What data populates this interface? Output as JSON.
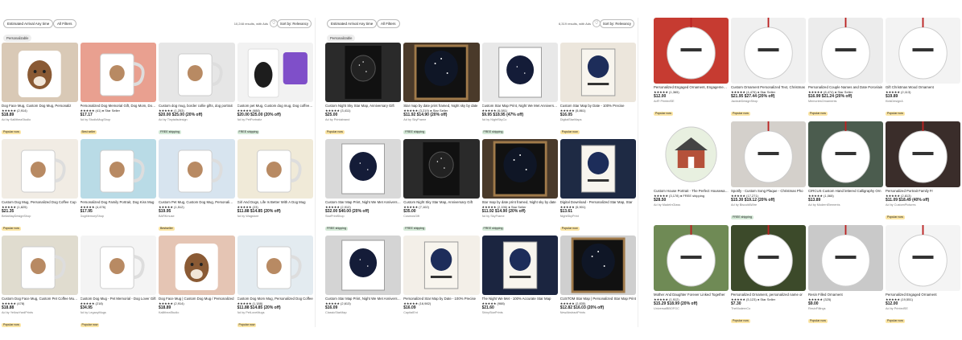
{
  "panels": [
    {
      "filter_label": "Estimated Arrival Any time",
      "all_filters_label": "All Filters",
      "results_text": "10,248 results, with Ads",
      "sort_label": "Sort by: Relevancy",
      "applied_filter": "Personalizable",
      "products": [
        {
          "title": "Dog Face Mug, Custom Dog Mug, Personaliz",
          "rating": "★★★★★ (2,914)",
          "price": "$18.89",
          "shop": "Ad by KallitheaStudio",
          "badge": "Popular now",
          "bg": "#d9c9b6",
          "art": "dog"
        },
        {
          "title": "Personalized Dog Memorial Gift, Dog Mom, Dog Lover",
          "rating": "★★★★★ (41) ● Star Seller",
          "price": "$17.17",
          "shop": "Ad by StudioMugShop",
          "badge": "Best seller",
          "bg": "#e9a090",
          "art": "mug"
        },
        {
          "title": "Custom dog mug, border collie gifts, dog portrait",
          "rating": "★★★★★ (1,253)",
          "price": "$20.00 $25.00 (20% off)",
          "shop": "Ad by Tinytailsdesign",
          "badge": "FREE shipping",
          "bg": "#e6e6e6",
          "art": "mug"
        },
        {
          "title": "Custom pet Mug, Custom dog mug, Dog coffee mug",
          "rating": "★★★★★ (688)",
          "price": "$20.00 $25.00 (20% off)",
          "shop": "Ad by PetPortraitz",
          "badge": "FREE shipping",
          "bg": "#f2f2f2",
          "art": "dogportrait"
        },
        {
          "title": "Custom Dog Mug, Personalized Dog Coffee Cup",
          "rating": "★★★★★ (1,825)",
          "price": "$21.35",
          "shop": "BellaMayDesignShop",
          "badge": "Popular now",
          "bg": "#f1ece4",
          "art": "mug"
        },
        {
          "title": "Personalized Dog Family Portrait, Dog Kiss Mug",
          "rating": "★★★★★ (4,476)",
          "price": "$17.95",
          "shop": "DogMemoryShop",
          "badge": "",
          "bg": "#b9dbe6",
          "art": "mug"
        },
        {
          "title": "Custom Pet Mug, Custom Dog Mug, Personalized Pet",
          "rating": "★★★★★ (1,512)",
          "price": "$19.95",
          "shop": "BARKmuse",
          "badge": "Bestseller",
          "bg": "#d7e4ef",
          "art": "mug"
        },
        {
          "title": "Girl And Dogs, Life Is Better With A Dog Mug",
          "rating": "★★★★★ (23)",
          "price": "$11.88 $14.85 (20% off)",
          "shop": "Ad by Wagstore",
          "badge": "",
          "bg": "#f0ead8",
          "art": "mug"
        },
        {
          "title": "Custom Dog Face Mug, Custom Pet Coffee Mug from Dog Photo",
          "rating": "★★★★★ (478)",
          "price": "$18.88",
          "shop": "Ad by YellowYardPrints",
          "badge": "Popular now",
          "bg": "#e0dccf",
          "art": "mug"
        },
        {
          "title": "Custom Dog Mug - Pet Memorial - Dog Lover Gift",
          "rating": "★★★★★ (218)",
          "price": "$34.95",
          "shop": "Ad by LegacyMugs",
          "badge": "Popular now",
          "bg": "#f4f4f4",
          "art": "mug"
        },
        {
          "title": "Dog Face Mug | Custom Dog Mug / Personalized",
          "rating": "★★★★★ (2,914)",
          "price": "$18.89",
          "shop": "KallitheaStudio",
          "badge": "",
          "bg": "#e5c5b4",
          "art": "dog"
        },
        {
          "title": "Custom Dog Mom Mug, Personalized Dog Coffee",
          "rating": "★★★★★ (1,188)",
          "price": "$11.88 $14.85 (20% off)",
          "shop": "Ad by PetLoveMugs",
          "badge": "Popular now",
          "bg": "#e3ebf0",
          "art": "mug"
        }
      ]
    },
    {
      "filter_label": "Estimated Arrival Any time",
      "all_filters_label": "All Filters",
      "results_text": "6,319 results, with Ads",
      "sort_label": "Sort by: Relevancy",
      "applied_filter": "Personalizable",
      "products": [
        {
          "title": "Custom Night Sky Star Map, Anniversary Gift",
          "rating": "★★★★★ (3,411)",
          "price": "$25.00",
          "shop": "Ad by Printabrand",
          "badge": "Popular now",
          "bg": "#2a2a2a",
          "art": "starframe"
        },
        {
          "title": "Star map by date print framed, Night sky by date",
          "rating": "★★★★★ (3,219) ● Star Seller",
          "price": "$11.92 $14.90 (20% off)",
          "shop": "Ad by SkyFrame",
          "badge": "FREE shipping",
          "bg": "#4a3a2a",
          "art": "starbig"
        },
        {
          "title": "Custom Star Map Print, Night We Met Anniversary",
          "rating": "★★★★★ (6,081)",
          "price": "$9.95 $18.95 (47% off)",
          "shop": "Ad by NightSkyCo",
          "badge": "FREE shipping",
          "bg": "#e8e8e8",
          "art": "stardisc"
        },
        {
          "title": "Custom Star Map by Date - 100% Precise",
          "rating": "★★★★★ (5,861)",
          "price": "$16.05",
          "shop": "DigitalStarMaps",
          "badge": "Popular now",
          "bg": "#ece6dc",
          "art": "starwall"
        },
        {
          "title": "Custom Star Map Print, Night We Met Anniversary",
          "rating": "★★★★★ (2,910)",
          "price": "$32.00 $40.00 (20% off)",
          "shop": "StarPrintShop",
          "badge": "FREE shipping",
          "bg": "#d9d9d9",
          "art": "stardisc"
        },
        {
          "title": "Custom Night Sky Star Map, Anniversary Gift",
          "rating": "★★★★★ (7,102)",
          "price": "$35.00",
          "shop": "CosmosGift",
          "badge": "FREE shipping",
          "bg": "#2a2a2a",
          "art": "starframe"
        },
        {
          "title": "Star map by date print framed, Night sky by date",
          "rating": "★★★★★ (2,196) ● Star Seller",
          "price": "$11.92 $14.90 (20% off)",
          "shop": "Ad by SkyFrame",
          "badge": "FREE shipping",
          "bg": "#4a3a2a",
          "art": "starbig"
        },
        {
          "title": "Digital Download - Personalized Star Map, Star",
          "rating": "★★★★★ (5,901)",
          "price": "$13.61",
          "shop": "NightSkyPrint",
          "badge": "Popular now",
          "bg": "#1e2a44",
          "art": "starwall"
        },
        {
          "title": "Custom Star Map Print, Night We Met Anniversary",
          "rating": "★★★★★ (2,613)",
          "price": "$16.09",
          "shop": "ClassicStarMap",
          "badge": "",
          "bg": "#d4d4d4",
          "art": "stardisc"
        },
        {
          "title": "Personalized Star Map by Date - 100% Precise",
          "rating": "★★★★★ (16,982)",
          "price": "$16.09",
          "shop": "CapitalEnt",
          "badge": "",
          "bg": "#f3efe8",
          "art": "starwall"
        },
        {
          "title": "The Night We Met - 100% Accurate Star Map",
          "rating": "★★★★★ (988)",
          "price": "$21.60",
          "shop": "ShinyStarPrints",
          "badge": "",
          "bg": "#1b2540",
          "art": "starwall"
        },
        {
          "title": "CUSTOM Star Map | Personalized Star Map Print",
          "rating": "★★★★★ (2,835)",
          "price": "$12.82 $16.03 (20% off)",
          "shop": "NewAbstractPrints",
          "badge": "",
          "bg": "#cfcfcf",
          "art": "starbig"
        }
      ]
    },
    {
      "filter_label": "",
      "all_filters_label": "",
      "results_text": "",
      "sort_label": "",
      "applied_filter": "",
      "products": [
        {
          "title": "Personalized Engaged Ornament, Engagement Gift",
          "rating": "★★★★★ (1,365)",
          "price": "$12.00",
          "shop": "Ad® PrintedSE",
          "badge": "Popular now",
          "bg": "#c63b31",
          "art": "ornament"
        },
        {
          "title": "Custom Ornament Personalized Text, Christmas",
          "rating": "★★★★★ (4,476) ● Star Seller",
          "price": "$21.95 $27.44 (20% off)",
          "shop": "JacksieDesignShop",
          "badge": "Popular now",
          "bg": "#f0f0f0",
          "art": "ornament"
        },
        {
          "title": "Personalized Couple Names and Date Porcelain",
          "rating": "★★★★★ (8,474) ● Star Seller",
          "price": "$16.99 $21.24 (20% off)",
          "shop": "MemoriesOrnaments",
          "badge": "Popular now",
          "bg": "#ececec",
          "art": "ornament"
        },
        {
          "title": "Gift Christmas Wood Ornament",
          "rating": "★★★★★ (2,113)",
          "price": "$19.89",
          "shop": "KidsDesignA",
          "badge": "Popular now",
          "bg": "#f3f3f3",
          "art": "ornament"
        },
        {
          "title": "Custom House Portrait - The Perfect Housewarming",
          "rating": "★★★★★ (3,178) ● FREE shipping",
          "price": "$28.50",
          "shop": "Ad by MadeInGlass",
          "badge": "",
          "bg": "#ffffff",
          "art": "house"
        },
        {
          "title": "Spotify - Custom Song Plaque - Christmas Pho",
          "rating": "★★★★★ (17,271)",
          "price": "$15.30 $19.12 (20% off)",
          "shop": "Ad by BiscuitAWire",
          "badge": "FREE shipping",
          "bg": "#d4d0cb",
          "art": "ornament"
        },
        {
          "title": "CIRCUS Custom Hand lettered Calligraphy Orn",
          "rating": "★★★★★ (1,065)",
          "price": "$13.89",
          "shop": "Ad by ModernElements",
          "badge": "",
          "bg": "#4b5c4e",
          "art": "ornament"
        },
        {
          "title": "Personalized Portrait Family Fr",
          "rating": "★★★★★ (2,813)",
          "price": "$11.09 $18.49 (40% off)",
          "shop": "Ad by CustomPictures",
          "badge": "Popular now",
          "bg": "#3a2d2a",
          "art": "ornament"
        },
        {
          "title": "Mother And Daughter Forever Linked Together",
          "rating": "★★★★★ (1,912)",
          "price": "$15.29 $18.99 (20% off)",
          "shop": "UniversalBBOFGC",
          "badge": "",
          "bg": "#6f8a55",
          "art": "ornament"
        },
        {
          "title": "Personalized Ornament, personalized name or",
          "rating": "★★★★★ (5,123) ● Star Seller",
          "price": "$7.30",
          "shop": "TheModernCo",
          "badge": "Popular now",
          "bg": "#3c4a2a",
          "art": "ornament"
        },
        {
          "title": "Resin Filled Ornament",
          "rating": "★★★★★ (325)",
          "price": "$9.00",
          "shop": "ResinFillings",
          "badge": "Popular now",
          "bg": "#c9c9c9",
          "art": "ornament"
        },
        {
          "title": "Personalized Engaged Ornament",
          "rating": "★★★★★ (19,551)",
          "price": "$12.00",
          "shop": "Ad by PrintedSE",
          "badge": "Popular now",
          "bg": "#f4f4f4",
          "art": "ornament"
        }
      ]
    }
  ]
}
